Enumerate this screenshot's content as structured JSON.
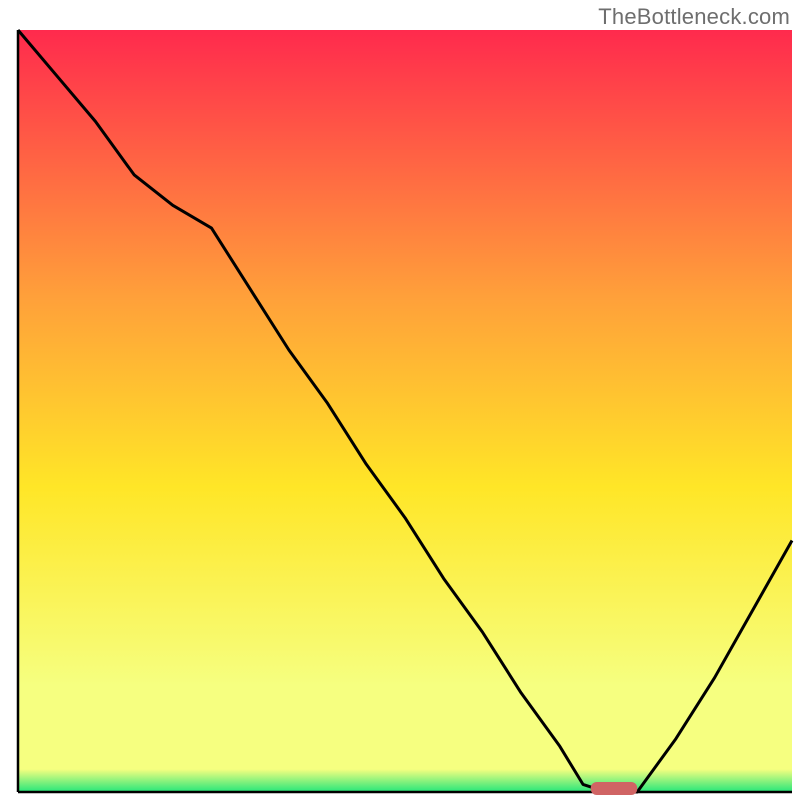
{
  "watermark": "TheBottleneck.com",
  "colors": {
    "red": "#ff2a4d",
    "orange": "#ffa03a",
    "yellow": "#ffe627",
    "ygreen": "#f6ff80",
    "green": "#25e67a",
    "curve": "#000000",
    "marker": "#d06464",
    "axes": "#000000"
  },
  "chart_data": {
    "type": "line",
    "title": "",
    "xlabel": "",
    "ylabel": "",
    "xlim": [
      0,
      100
    ],
    "ylim": [
      0,
      100
    ],
    "x": [
      0,
      5,
      10,
      15,
      20,
      25,
      30,
      35,
      40,
      45,
      50,
      55,
      60,
      65,
      70,
      73,
      76,
      80,
      85,
      90,
      95,
      100
    ],
    "values": [
      100,
      94,
      88,
      81,
      77,
      74,
      66,
      58,
      51,
      43,
      36,
      28,
      21,
      13,
      6,
      1,
      0,
      0,
      7,
      15,
      24,
      33
    ],
    "marker": {
      "x_start": 74,
      "x_end": 80,
      "y": 0
    },
    "gradient_stops": [
      {
        "offset": 0.0,
        "color_key": "red"
      },
      {
        "offset": 0.35,
        "color_key": "orange"
      },
      {
        "offset": 0.6,
        "color_key": "yellow"
      },
      {
        "offset": 0.86,
        "color_key": "ygreen"
      },
      {
        "offset": 0.97,
        "color_key": "ygreen"
      },
      {
        "offset": 1.0,
        "color_key": "green"
      }
    ]
  }
}
